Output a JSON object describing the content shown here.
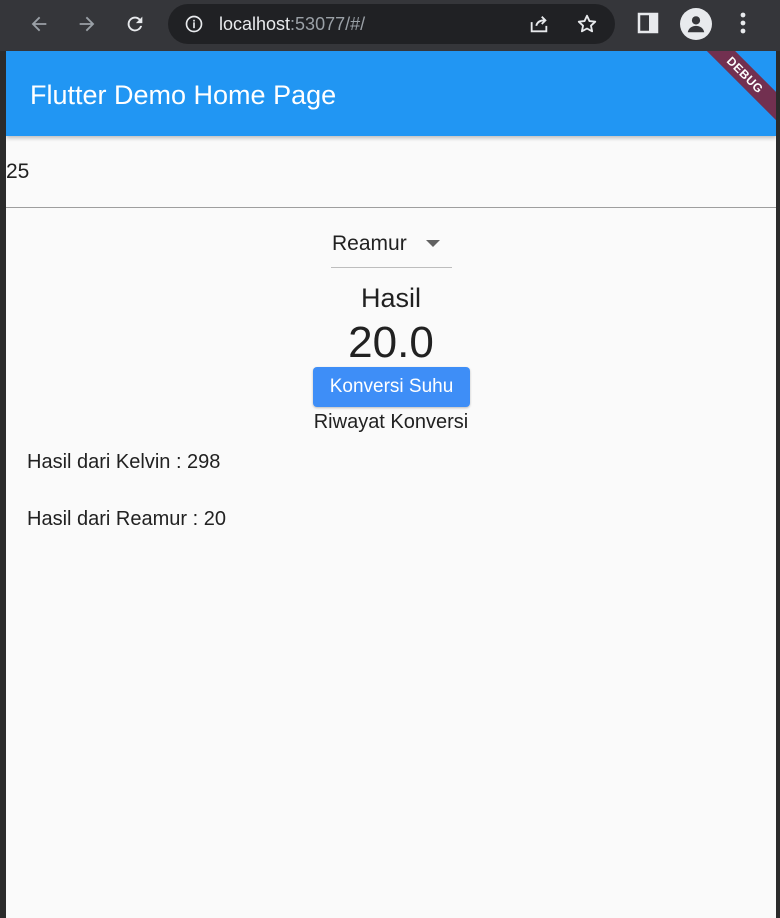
{
  "browser": {
    "url_host": "localhost",
    "url_rest": ":53077/#/"
  },
  "app": {
    "title": "Flutter Demo Home Page",
    "debug_label": "DEBUG",
    "input_value": "25",
    "dropdown": {
      "selected": "Reamur"
    },
    "result_label": "Hasil",
    "result_value": "20.0",
    "convert_button": "Konversi Suhu",
    "history_title": "Riwayat Konversi",
    "history": [
      "Hasil dari Kelvin : 298",
      "Hasil dari Reamur : 20"
    ]
  },
  "colors": {
    "appbar": "#2196f3",
    "button": "#3e8ef7",
    "debug_banner": "#801e32"
  },
  "icons": [
    "back-icon",
    "forward-icon",
    "reload-icon",
    "info-icon",
    "share-icon",
    "star-icon",
    "side-panel-icon",
    "profile-icon",
    "menu-icon",
    "dropdown-caret-icon"
  ]
}
